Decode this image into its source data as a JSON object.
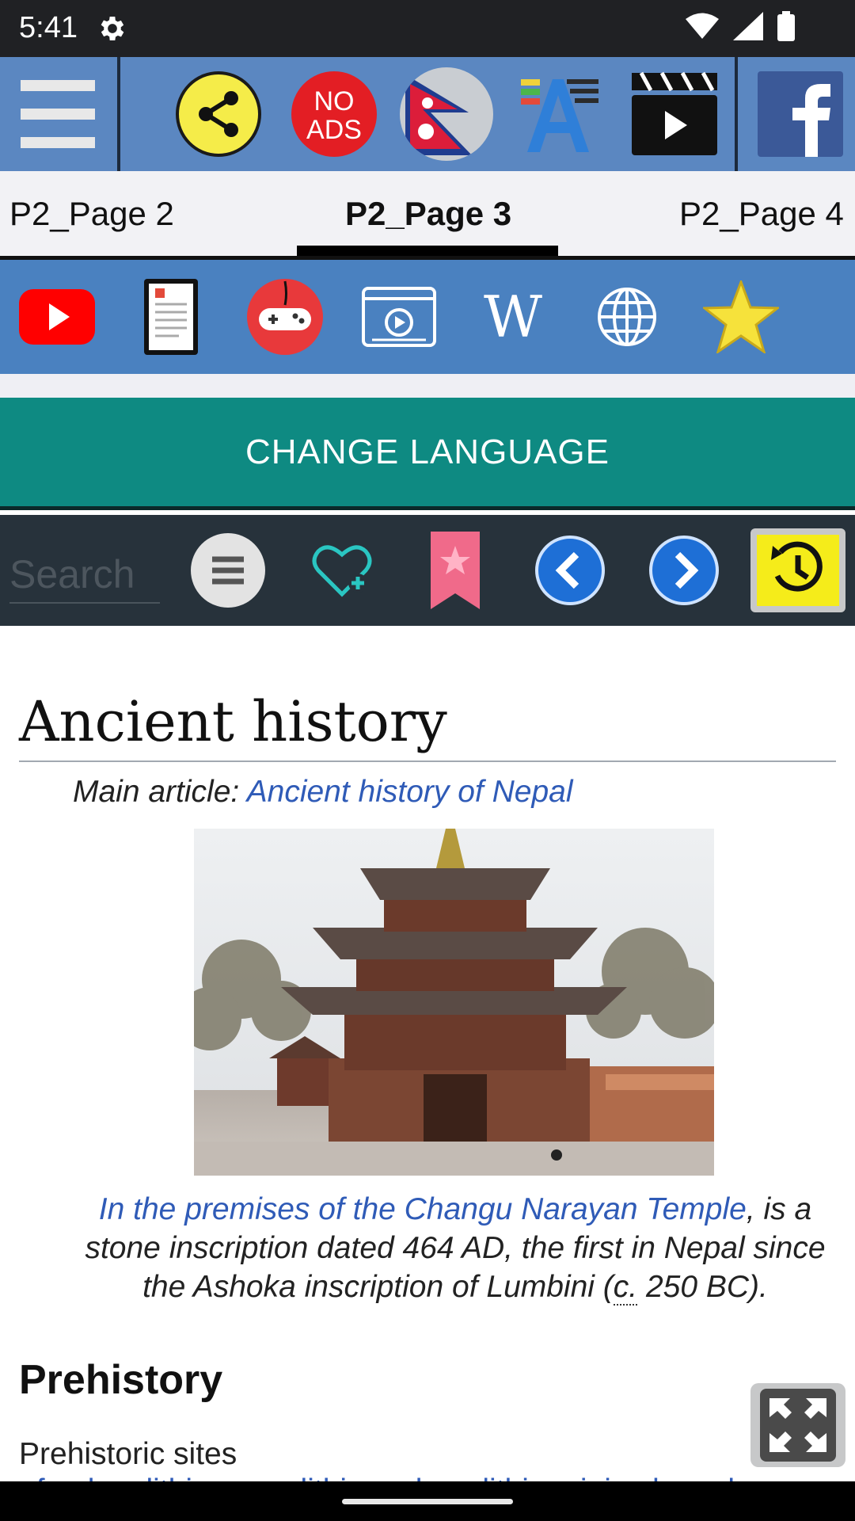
{
  "status_bar": {
    "time": "5:41"
  },
  "toolbar": {
    "menu_icon": "hamburger-menu-icon",
    "share_icon": "share-icon",
    "no_ads": {
      "line1": "NO",
      "line2": "ADS"
    },
    "flag_icon": "nepal-flag-icon",
    "font_icon": "text-size-icon",
    "video_icon": "video-clapper-icon",
    "facebook_icon": "facebook-icon",
    "colors": {
      "background": "#5b87c1",
      "no_ads_red": "#e31e24",
      "share_yellow": "#f5ec49",
      "facebook_blue": "#3b5998"
    }
  },
  "tabs": [
    {
      "label": "P2_Page 2",
      "active": false
    },
    {
      "label": "P2_Page 3",
      "active": true
    },
    {
      "label": "P2_Page 4",
      "active": false
    }
  ],
  "icon_row": {
    "icons": [
      "youtube-icon",
      "document-icon",
      "game-controller-icon",
      "video-player-icon",
      "wikipedia-icon",
      "globe-icon",
      "star-icon"
    ],
    "wikipedia_letter": "W",
    "colors": {
      "background": "#4a81c0"
    }
  },
  "change_language": {
    "label": "CHANGE LANGUAGE",
    "color": "#0e8a82"
  },
  "search_bar": {
    "placeholder": "Search",
    "icons": [
      "list-menu-icon",
      "heart-add-icon",
      "bookmark-icon",
      "back-arrow-icon",
      "forward-arrow-icon",
      "history-icon"
    ],
    "colors": {
      "background": "#27323b"
    }
  },
  "article": {
    "heading": "Ancient history",
    "hatnote_prefix": "Main article: ",
    "hatnote_link": "Ancient history of Nepal",
    "caption_link": "In the premises of the Changu Narayan Temple",
    "caption_rest": ", is a stone inscription dated 464 AD, the first in Nepal since the Ashoka inscription of Lumbini (",
    "caption_abbr": "c.",
    "caption_end": " 250 BC).",
    "subheading": "Prehistory",
    "paragraph_start": "Prehistoric sites",
    "paragraph_clipped": "of palaeolithic, mesolithic and neolithic origins have been"
  }
}
